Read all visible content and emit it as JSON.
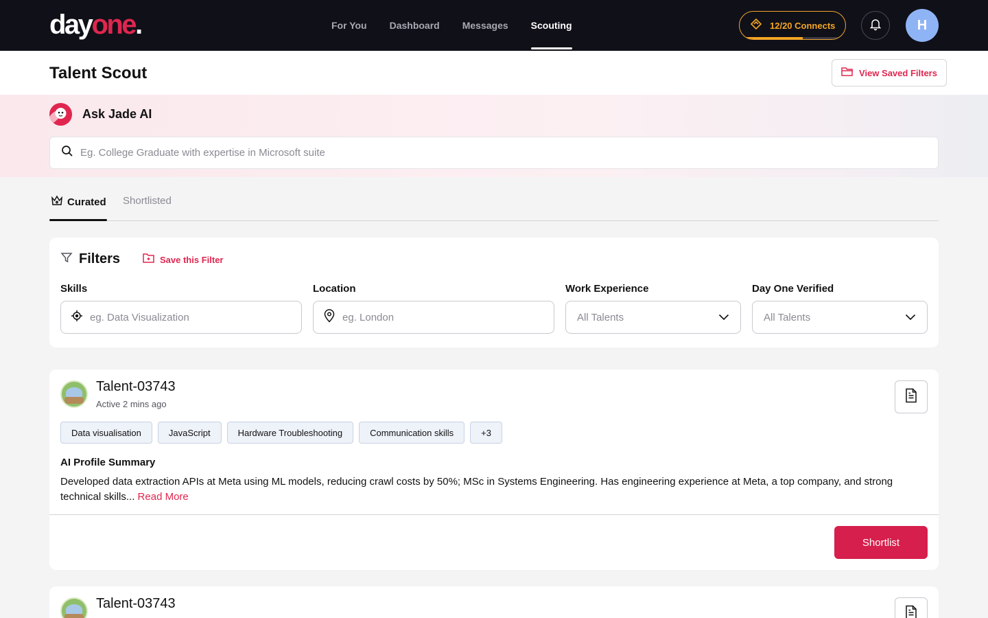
{
  "brand": {
    "logo_part1": "day",
    "logo_part2": "one",
    "logo_dot": "."
  },
  "nav": {
    "items": [
      {
        "label": "For You"
      },
      {
        "label": "Dashboard"
      },
      {
        "label": "Messages"
      },
      {
        "label": "Scouting"
      }
    ],
    "active": "Scouting"
  },
  "connects": {
    "label": "12/20 Connects",
    "used": 12,
    "total": 20,
    "fraction": 0.6
  },
  "user": {
    "initial": "H"
  },
  "header": {
    "title": "Talent Scout",
    "saved_filters_label": "View Saved Filters"
  },
  "jade": {
    "title": "Ask Jade AI",
    "search_placeholder": "Eg. College Graduate with expertise in Microsoft suite"
  },
  "tabs": [
    {
      "label": "Curated"
    },
    {
      "label": "Shortlisted"
    }
  ],
  "filters": {
    "title": "Filters",
    "save_label": "Save this Filter",
    "skills": {
      "label": "Skills",
      "placeholder": "eg. Data Visualization"
    },
    "location": {
      "label": "Location",
      "placeholder": "eg. London"
    },
    "work_experience": {
      "label": "Work Experience",
      "value": "All Talents"
    },
    "verified": {
      "label": "Day One Verified",
      "value": "All Talents"
    }
  },
  "talents": [
    {
      "name": "Talent-03743",
      "active": "Active 2 mins ago",
      "skills": [
        "Data visualisation",
        "JavaScript",
        "Hardware Troubleshooting",
        "Communication skills",
        "+3"
      ],
      "summary_title": "AI Profile Summary",
      "summary": "Developed data extraction APIs at  Meta using ML models, reducing crawl costs by 50%; MSc in Systems  Engineering. Has engineering experience at Meta, a top company, and strong technical skills...",
      "read_more": "Read More",
      "action": "Shortlist"
    },
    {
      "name": "Talent-03743"
    }
  ],
  "colors": {
    "accent": "#e0264f",
    "nav_bg": "#101018",
    "connects": "#f5a623",
    "avatar": "#8fb4f5"
  }
}
